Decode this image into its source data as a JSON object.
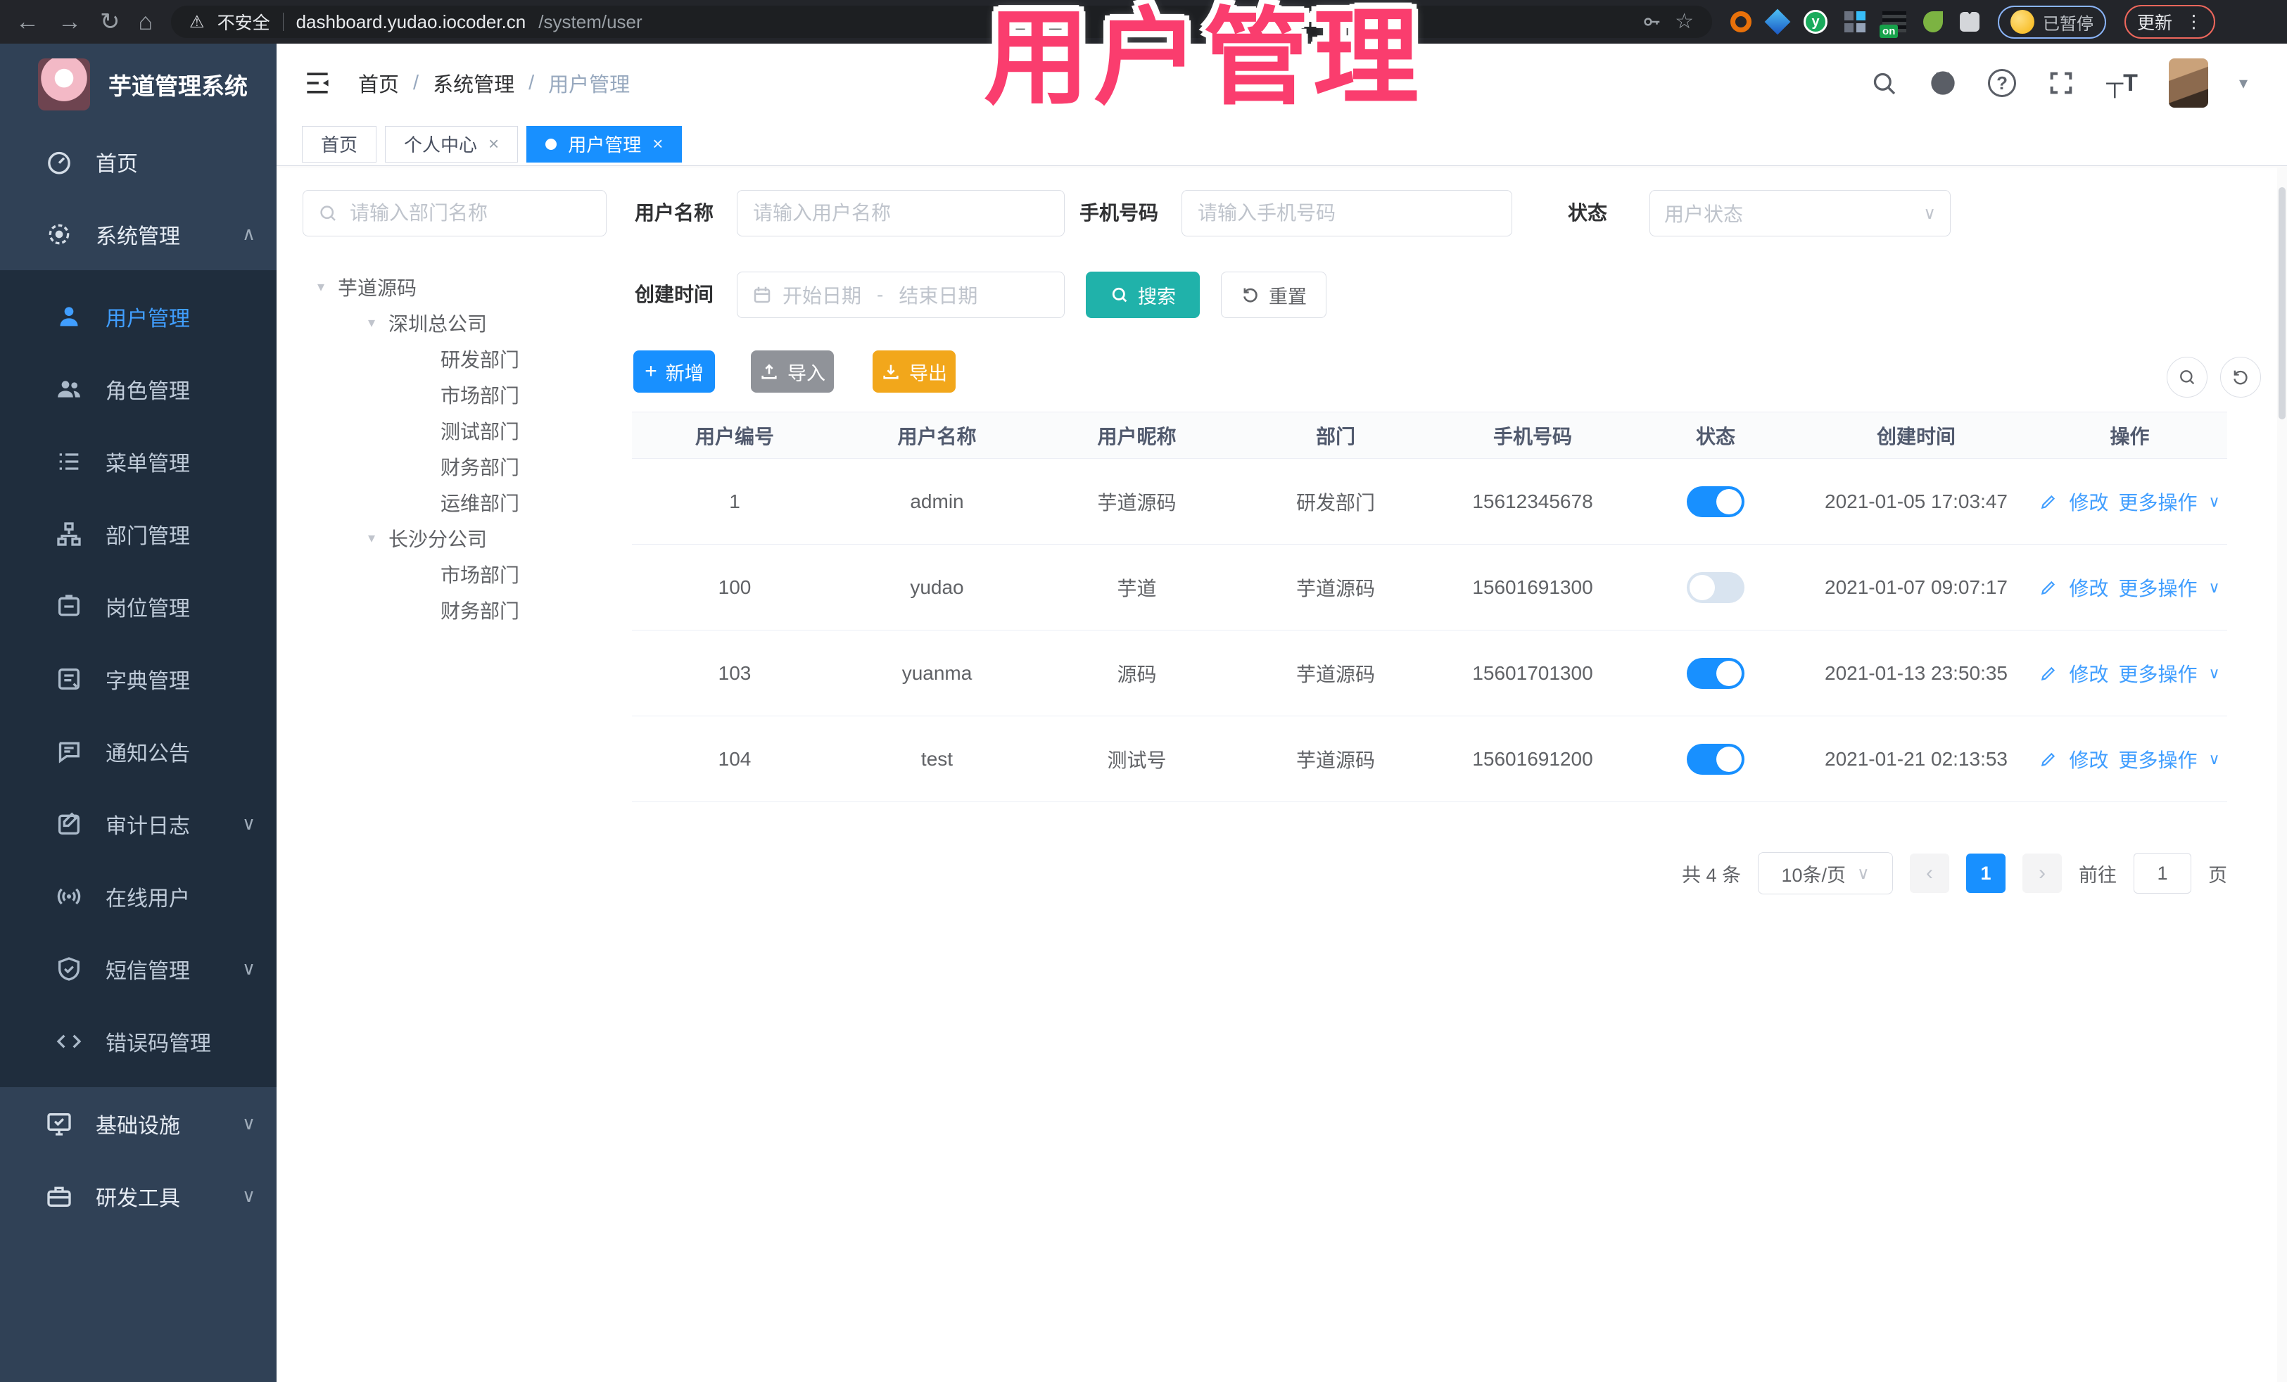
{
  "browser": {
    "security_label": "不安全",
    "url_host": "dashboard.yudao.iocoder.cn",
    "url_path": "/system/user",
    "profile_status": "已暂停",
    "update_label": "更新"
  },
  "annotation": {
    "title": "用户管理",
    "color": "#FA3D6E"
  },
  "app": {
    "title": "芋道管理系统"
  },
  "breadcrumb": {
    "items": [
      "首页",
      "系统管理",
      "用户管理"
    ]
  },
  "tabs": [
    {
      "label": "首页",
      "closable": false,
      "active": false
    },
    {
      "label": "个人中心",
      "closable": true,
      "active": false
    },
    {
      "label": "用户管理",
      "closable": true,
      "active": true
    }
  ],
  "sidebar": {
    "items": [
      {
        "label": "首页",
        "icon": "gauge-icon"
      },
      {
        "label": "系统管理",
        "icon": "gear-icon",
        "chevron": "up"
      },
      {
        "label": "用户管理",
        "icon": "user-icon",
        "active": true
      },
      {
        "label": "角色管理",
        "icon": "users-icon"
      },
      {
        "label": "菜单管理",
        "icon": "menu-list-icon"
      },
      {
        "label": "部门管理",
        "icon": "org-tree-icon"
      },
      {
        "label": "岗位管理",
        "icon": "badge-icon"
      },
      {
        "label": "字典管理",
        "icon": "book-icon"
      },
      {
        "label": "通知公告",
        "icon": "speech-bubble-icon"
      },
      {
        "label": "审计日志",
        "icon": "edit-log-icon",
        "chevron": "down"
      },
      {
        "label": "在线用户",
        "icon": "online-signal-icon"
      },
      {
        "label": "短信管理",
        "icon": "shield-check-icon",
        "chevron": "down"
      },
      {
        "label": "错误码管理",
        "icon": "code-icon"
      },
      {
        "label": "基础设施",
        "icon": "monitor-icon",
        "chevron": "down"
      },
      {
        "label": "研发工具",
        "icon": "briefcase-icon",
        "chevron": "down"
      }
    ]
  },
  "dept": {
    "search_placeholder": "请输入部门名称",
    "tree": [
      {
        "label": "芋道源码"
      },
      {
        "label": "深圳总公司"
      },
      {
        "label": "研发部门"
      },
      {
        "label": "市场部门"
      },
      {
        "label": "测试部门"
      },
      {
        "label": "财务部门"
      },
      {
        "label": "运维部门"
      },
      {
        "label": "长沙分公司"
      },
      {
        "label": "市场部门"
      },
      {
        "label": "财务部门"
      }
    ]
  },
  "filters": {
    "username_label": "用户名称",
    "username_placeholder": "请输入用户名称",
    "mobile_label": "手机号码",
    "mobile_placeholder": "请输入手机号码",
    "status_label": "状态",
    "status_placeholder": "用户状态",
    "create_time_label": "创建时间",
    "date_start_placeholder": "开始日期",
    "date_separator": "-",
    "date_end_placeholder": "结束日期",
    "search_label": "搜索",
    "reset_label": "重置"
  },
  "toolbar": {
    "add_label": "新增",
    "import_label": "导入",
    "export_label": "导出"
  },
  "table": {
    "columns": [
      "用户编号",
      "用户名称",
      "用户昵称",
      "部门",
      "手机号码",
      "状态",
      "创建时间",
      "操作"
    ],
    "actions": {
      "edit": "修改",
      "more": "更多操作"
    },
    "rows": [
      {
        "id": "1",
        "username": "admin",
        "nickname": "芋道源码",
        "dept": "研发部门",
        "mobile": "15612345678",
        "status": "on",
        "created": "2021-01-05 17:03:47"
      },
      {
        "id": "100",
        "username": "yudao",
        "nickname": "芋道",
        "dept": "芋道源码",
        "mobile": "15601691300",
        "status": "off",
        "created": "2021-01-07 09:07:17"
      },
      {
        "id": "103",
        "username": "yuanma",
        "nickname": "源码",
        "dept": "芋道源码",
        "mobile": "15601701300",
        "status": "on",
        "created": "2021-01-13 23:50:35"
      },
      {
        "id": "104",
        "username": "test",
        "nickname": "测试号",
        "dept": "芋道源码",
        "mobile": "15601691200",
        "status": "on",
        "created": "2021-01-21 02:13:53"
      }
    ]
  },
  "pagination": {
    "total": "共 4 条",
    "page_size": "10条/页",
    "page": "1",
    "goto_label": "前往",
    "goto_value": "1",
    "unit_label": "页"
  },
  "colors": {
    "accent_blue": "#1890FF",
    "menu_active_blue": "#409EFF",
    "search_teal": "#20B2AA",
    "export_orange": "#F2A71B",
    "import_gray": "#909399",
    "annotation_pink": "#FA3D6E",
    "sidebar_bg": "#304156",
    "submenu_bg": "#1F2D3D"
  }
}
